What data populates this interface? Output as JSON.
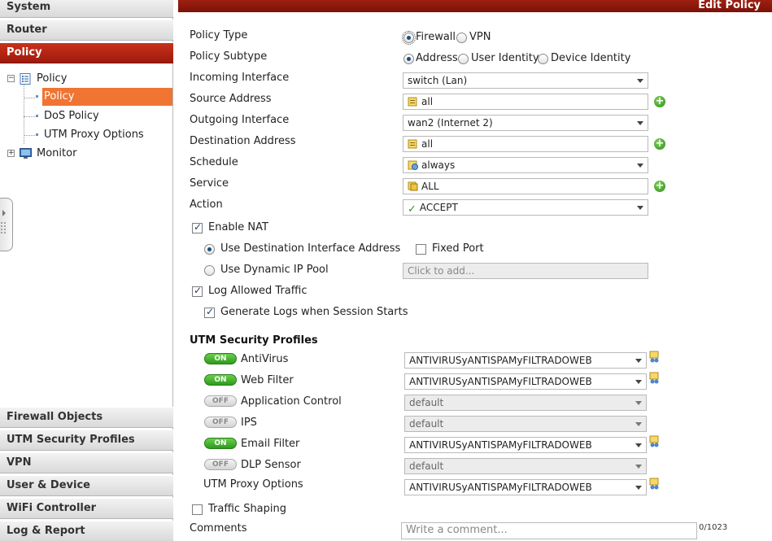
{
  "sidebar": {
    "top_sections": [
      "System",
      "Router",
      "Policy"
    ],
    "tree": {
      "policy_root": "Policy",
      "policy_children": [
        "Policy",
        "DoS Policy",
        "UTM Proxy Options"
      ],
      "monitor": "Monitor"
    },
    "bottom_sections": [
      "Firewall Objects",
      "UTM Security Profiles",
      "VPN",
      "User & Device",
      "WiFi Controller",
      "Log & Report"
    ]
  },
  "header": {
    "title": "Edit Policy"
  },
  "form": {
    "policy_type": {
      "label": "Policy Type",
      "options": [
        "Firewall",
        "VPN"
      ],
      "selected": "Firewall"
    },
    "policy_subtype": {
      "label": "Policy Subtype",
      "options": [
        "Address",
        "User Identity",
        "Device Identity"
      ],
      "selected": "Address"
    },
    "incoming_interface": {
      "label": "Incoming Interface",
      "value": "switch (Lan)"
    },
    "source_address": {
      "label": "Source Address",
      "value": "all"
    },
    "outgoing_interface": {
      "label": "Outgoing Interface",
      "value": "wan2 (Internet 2)"
    },
    "destination_address": {
      "label": "Destination Address",
      "value": "all"
    },
    "schedule": {
      "label": "Schedule",
      "value": "always"
    },
    "service": {
      "label": "Service",
      "value": "ALL"
    },
    "action": {
      "label": "Action",
      "value": "ACCEPT"
    },
    "enable_nat": {
      "label": "Enable NAT",
      "checked": true
    },
    "use_dest_iface": {
      "label": "Use Destination Interface Address",
      "selected": true
    },
    "fixed_port": {
      "label": "Fixed Port",
      "checked": false
    },
    "use_dynamic_ip_pool": {
      "label": "Use Dynamic IP Pool",
      "selected": false,
      "placeholder": "Click to add..."
    },
    "log_allowed": {
      "label": "Log Allowed Traffic",
      "checked": true
    },
    "gen_logs": {
      "label": "Generate Logs when Session Starts",
      "checked": true
    },
    "utm_title": "UTM Security Profiles",
    "utm_profiles": [
      {
        "name": "AntiVirus",
        "state": "ON",
        "value": "ANTIVIRUSyANTISPAMyFILTRADOWEB",
        "enabled": true
      },
      {
        "name": "Web Filter",
        "state": "ON",
        "value": "ANTIVIRUSyANTISPAMyFILTRADOWEB",
        "enabled": true
      },
      {
        "name": "Application Control",
        "state": "OFF",
        "value": "default",
        "enabled": false
      },
      {
        "name": "IPS",
        "state": "OFF",
        "value": "default",
        "enabled": false
      },
      {
        "name": "Email Filter",
        "state": "ON",
        "value": "ANTIVIRUSyANTISPAMyFILTRADOWEB",
        "enabled": true
      },
      {
        "name": "DLP Sensor",
        "state": "OFF",
        "value": "default",
        "enabled": false
      }
    ],
    "utm_proxy": {
      "label": "UTM Proxy Options",
      "value": "ANTIVIRUSyANTISPAMyFILTRADOWEB"
    },
    "traffic_shaping": {
      "label": "Traffic Shaping",
      "checked": false
    },
    "comments": {
      "label": "Comments",
      "placeholder": "Write a comment...",
      "count": "0/1023"
    }
  },
  "colors": {
    "accent_red": "#b02314",
    "selected_orange": "#f07432",
    "toggle_green": "#3aa826"
  }
}
